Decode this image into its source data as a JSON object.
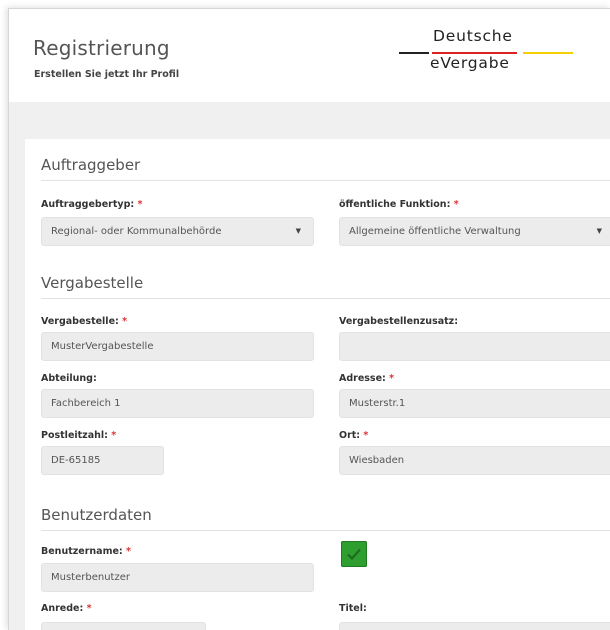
{
  "header": {
    "title": "Registrierung",
    "subtitle": "Erstellen Sie jetzt Ihr Profil",
    "logo": {
      "line1": "Deutsche",
      "line2": "eVergabe",
      "colors": {
        "black": "#222222",
        "red": "#dd2222",
        "gold": "#f5d000"
      }
    }
  },
  "sections": {
    "auftraggeber": {
      "title": "Auftraggeber",
      "typ": {
        "label": "Auftraggebertyp:",
        "required": "*",
        "value": "Regional- oder Kommunalbehörde"
      },
      "funktion": {
        "label": "öffentliche Funktion:",
        "required": "*",
        "value": "Allgemeine öffentliche Verwaltung"
      }
    },
    "vergabestelle": {
      "title": "Vergabestelle",
      "name": {
        "label": "Vergabestelle:",
        "required": "*",
        "value": "MusterVergabestelle"
      },
      "zusatz": {
        "label": "Vergabestellenzusatz:",
        "value": ""
      },
      "abteilung": {
        "label": "Abteilung:",
        "value": "Fachbereich 1"
      },
      "adresse": {
        "label": "Adresse:",
        "required": "*",
        "value": "Musterstr.1"
      },
      "plz": {
        "label": "Postleitzahl:",
        "required": "*",
        "value": "DE-65185"
      },
      "ort": {
        "label": "Ort:",
        "required": "*",
        "value": "Wiesbaden"
      }
    },
    "benutzerdaten": {
      "title": "Benutzerdaten",
      "benutzername": {
        "label": "Benutzername:",
        "required": "*",
        "value": "Musterbenutzer",
        "valid": true
      },
      "anrede": {
        "label": "Anrede:",
        "required": "*"
      },
      "titel": {
        "label": "Titel:"
      }
    }
  },
  "colors": {
    "required": "#dd3333",
    "valid_check": "#2e9e2e"
  },
  "icons": {
    "dropdown": "caret-down-icon",
    "valid": "checkmark-icon"
  }
}
